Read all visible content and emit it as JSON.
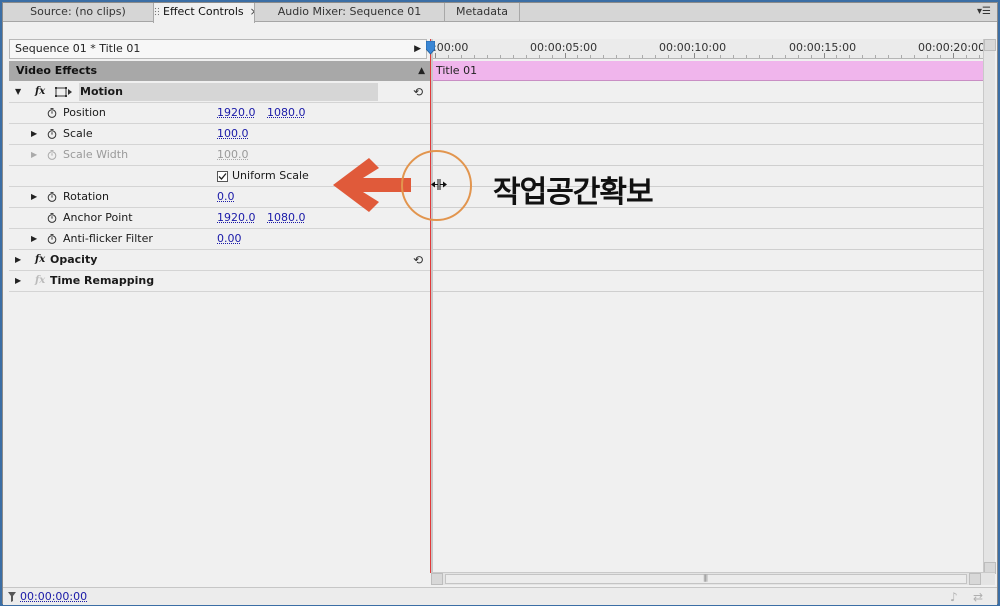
{
  "tabs": [
    {
      "label": "Source: (no clips)",
      "active": false
    },
    {
      "label": "Effect Controls",
      "active": true
    },
    {
      "label": "Audio Mixer: Sequence 01",
      "active": false
    },
    {
      "label": "Metadata",
      "active": false
    }
  ],
  "panel_menu_icon": "panel-menu-icon",
  "header": {
    "sequence_title": "Sequence 01 * Title 01"
  },
  "ruler": {
    "labels": [
      ":00:00",
      "00:00:05:00",
      "00:00:10:00",
      "00:00:15:00",
      "00:00:20:00"
    ]
  },
  "video_effects": {
    "label": "Video Effects"
  },
  "clip": {
    "name": "Title 01",
    "color": "#f0b5ec"
  },
  "motion": {
    "label": "Motion",
    "position": {
      "label": "Position",
      "x": "1920.0",
      "y": "1080.0"
    },
    "scale": {
      "label": "Scale",
      "value": "100.0"
    },
    "scale_width": {
      "label": "Scale Width",
      "value": "100.0"
    },
    "uniform_scale": {
      "label": "Uniform Scale",
      "checked": true
    },
    "rotation": {
      "label": "Rotation",
      "value": "0.0"
    },
    "anchor_point": {
      "label": "Anchor Point",
      "x": "1920.0",
      "y": "1080.0"
    },
    "anti_flicker": {
      "label": "Anti-flicker Filter",
      "value": "0.00"
    }
  },
  "opacity": {
    "label": "Opacity"
  },
  "time_remapping": {
    "label": "Time Remapping"
  },
  "footer": {
    "timecode": "00:00:00:00"
  },
  "annotation": {
    "text": "작업공간확보",
    "arrow_color": "#e05a3a",
    "circle_color": "#e2954e"
  },
  "colors": {
    "playhead": "#e03a3a",
    "value_link": "#1a1aa8",
    "window_border": "#3b6ea5"
  }
}
